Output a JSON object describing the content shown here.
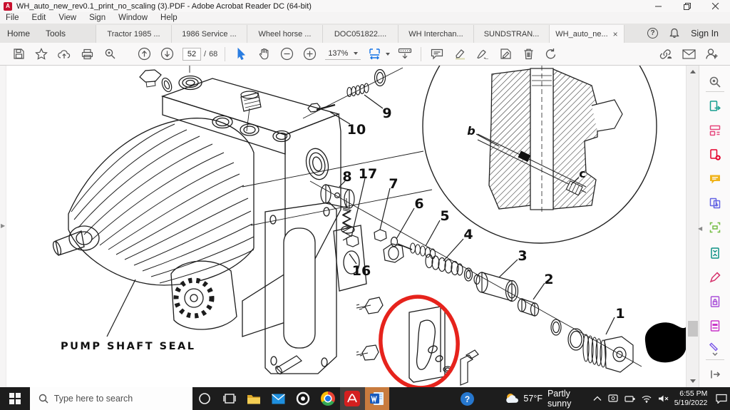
{
  "window": {
    "title": "WH_auto_new_rev0.1_print_no_scaling (3).PDF - Adobe Acrobat Reader DC (64-bit)"
  },
  "menu": {
    "items": [
      "File",
      "Edit",
      "View",
      "Sign",
      "Window",
      "Help"
    ]
  },
  "tabs": {
    "home": "Home",
    "tools": "Tools",
    "docs": [
      "Tractor 1985 ...",
      "1986 Service ...",
      "Wheel horse ...",
      "DOC051822....",
      "WH Interchan...",
      "SUNDSTRAN..."
    ],
    "active": "WH_auto_ne...",
    "close_glyph": "×",
    "help_glyph": "?",
    "sign_in": "Sign In"
  },
  "toolbar": {
    "page_current": "52",
    "page_divider": "/",
    "page_total": "68",
    "zoom_level": "137%"
  },
  "document": {
    "labels": {
      "pump_shaft_seal": "PUMP SHAFT SEAL"
    },
    "callouts": [
      "1",
      "2",
      "3",
      "4",
      "5",
      "6",
      "7",
      "8",
      "9",
      "10",
      "16",
      "17",
      "b",
      "c"
    ],
    "annotation_color": "#e6231c",
    "accent_blue": "#1473e6"
  },
  "tools_panel": {
    "items": [
      {
        "name": "search",
        "color": "#6a6a6a"
      },
      {
        "name": "export-pdf",
        "color": "#169e8f"
      },
      {
        "name": "organize-pages",
        "color": "#e6477d"
      },
      {
        "name": "create-pdf",
        "color": "#e4002b"
      },
      {
        "name": "comment",
        "color": "#f0b41c"
      },
      {
        "name": "combine-files",
        "color": "#6464e3"
      },
      {
        "name": "edit-pdf",
        "color": "#74bd44"
      },
      {
        "name": "compress-pdf",
        "color": "#0e9184"
      },
      {
        "name": "fill-sign",
        "color": "#d6336c"
      },
      {
        "name": "protect-pdf",
        "color": "#a94fd8"
      },
      {
        "name": "redact",
        "color": "#c935c9"
      },
      {
        "name": "more-tools",
        "color": "#7f5be8"
      }
    ]
  },
  "taskbar": {
    "search_placeholder": "Type here to search",
    "weather": {
      "temp": "57°F",
      "condition": "Partly sunny"
    },
    "clock": {
      "time": "6:55 PM",
      "date": "5/19/2022"
    }
  }
}
